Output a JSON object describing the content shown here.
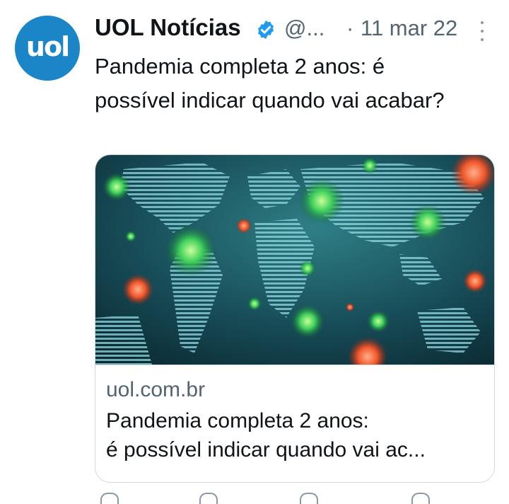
{
  "tweet": {
    "avatar_text": "uol",
    "display_name": "UOL Notícias",
    "handle": "@...",
    "separator": "·",
    "timestamp": "11 mar 22",
    "text": "Pandemia completa 2 anos: é possível indicar quando vai acabar?"
  },
  "card": {
    "image_alt": "Mapa-múndi com vírus",
    "domain": "uol.com.br",
    "title_line1": "Pandemia completa 2 anos:",
    "title_line2": "é possível indicar quando vai ac..."
  },
  "icons": {
    "verified": "verified-badge-icon",
    "more": "more-options-icon"
  },
  "colors": {
    "avatar_bg": "#1a86c8",
    "verified": "#1d9bf0",
    "secondary_text": "#536471",
    "card_border": "#cfd9de"
  }
}
